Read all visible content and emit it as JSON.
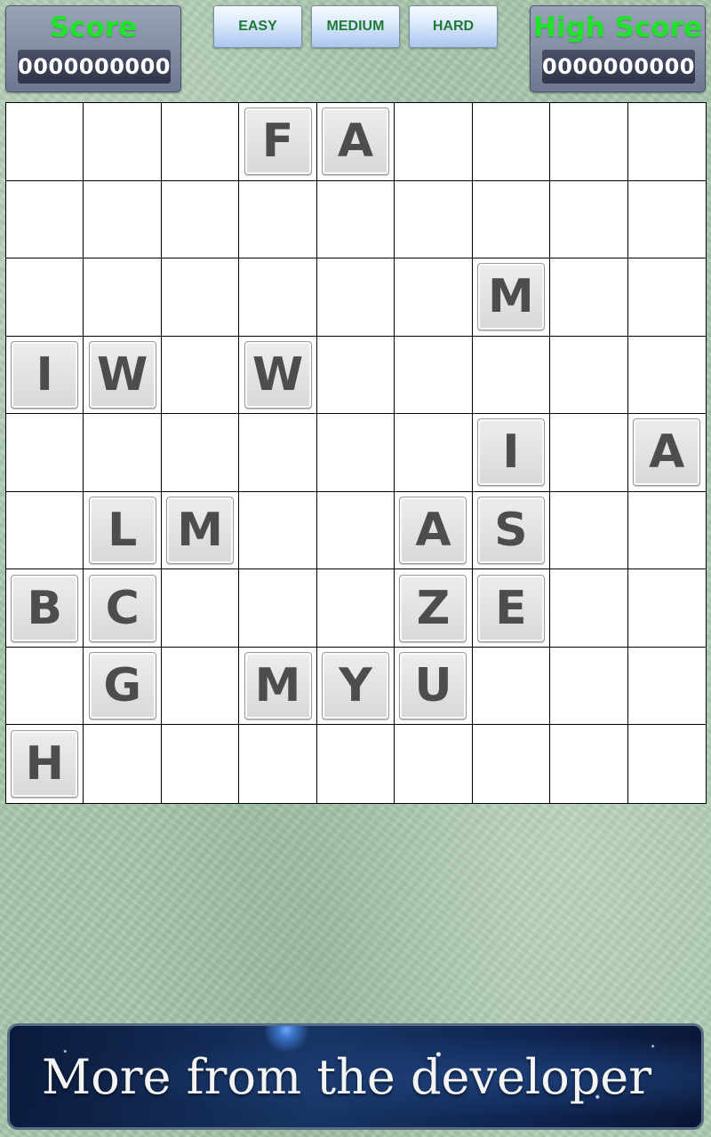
{
  "score_panel": {
    "label": "Score",
    "value": "0000000000"
  },
  "high_score_panel": {
    "label": "High Score",
    "value": "0000000000"
  },
  "difficulty_buttons": {
    "easy": "EASY",
    "medium": "MEDIUM",
    "hard": "HARD"
  },
  "colors": {
    "score_label": "#21e32b",
    "difficulty_text": "#1f7a36",
    "tile_letter": "#4d4d4d",
    "background": "#a9c8ad"
  },
  "board": {
    "rows": 9,
    "cols": 9,
    "grid": [
      [
        "",
        "",
        "",
        "F",
        "A",
        "",
        "",
        "",
        ""
      ],
      [
        "",
        "",
        "",
        "",
        "",
        "",
        "",
        "",
        ""
      ],
      [
        "",
        "",
        "",
        "",
        "",
        "",
        "M",
        "",
        ""
      ],
      [
        "I",
        "W",
        "",
        "W",
        "",
        "",
        "",
        "",
        ""
      ],
      [
        "",
        "",
        "",
        "",
        "",
        "",
        "I",
        "",
        "A"
      ],
      [
        "",
        "L",
        "M",
        "",
        "",
        "A",
        "S",
        "",
        ""
      ],
      [
        "B",
        "C",
        "",
        "",
        "",
        "Z",
        "E",
        "",
        ""
      ],
      [
        "",
        "G",
        "",
        "M",
        "Y",
        "U",
        "",
        "",
        ""
      ],
      [
        "H",
        "",
        "",
        "",
        "",
        "",
        "",
        "",
        ""
      ]
    ]
  },
  "promo_banner": {
    "text": "More from the developer"
  }
}
